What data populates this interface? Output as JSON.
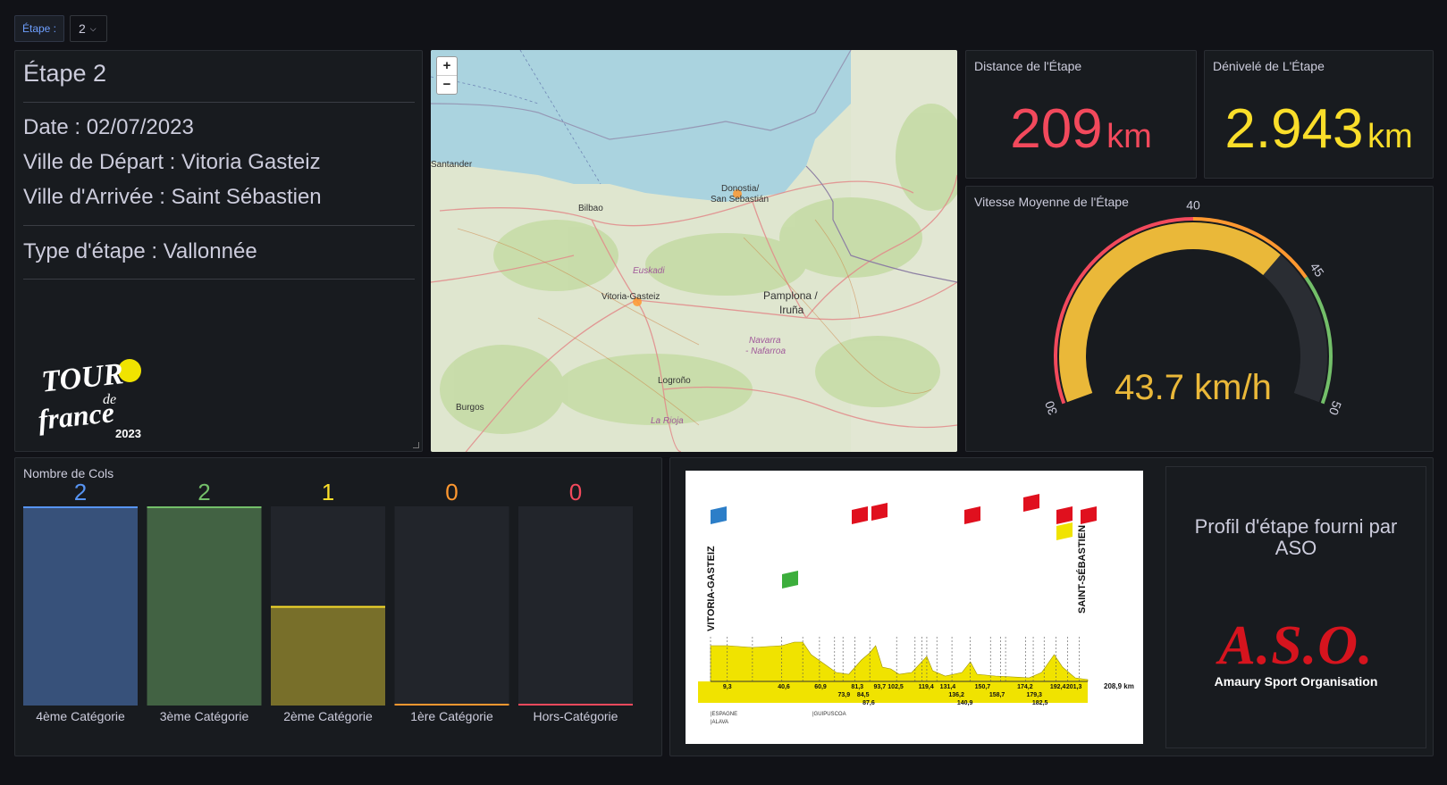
{
  "variable": {
    "label": "Étape :",
    "value": "2"
  },
  "info": {
    "title": "Étape 2",
    "date": "Date : 02/07/2023",
    "depart": "Ville de Départ : Vitoria Gasteiz",
    "arrivee": "Ville d'Arrivée : Saint Sébastien",
    "type": "Type d'étape : Vallonnée",
    "logo_text": [
      "TOUR",
      "de",
      "france",
      "2023"
    ]
  },
  "map": {
    "zoom_in": "+",
    "zoom_out": "−",
    "cities": [
      "Santander",
      "Bilbao",
      "Donostia/",
      "San Sebastián",
      "Euskadi",
      "Vitoria-Gasteiz",
      "Pamplona /",
      "Iruña",
      "Navarra",
      "- Nafarroa",
      "Logroño",
      "Burgos",
      "La Rioja"
    ]
  },
  "distance": {
    "title": "Distance de l'Étape",
    "value": "209",
    "unit": "km",
    "color": "#f2495c"
  },
  "denivele": {
    "title": "Dénivelé de L'Étape",
    "value": "2.943",
    "unit": "km",
    "color": "#fade2a"
  },
  "gauge": {
    "title": "Vitesse Moyenne de l'Étape",
    "value": 43.7,
    "display": "43.7 km/h",
    "min": 30,
    "max": 50,
    "thresholds": [
      {
        "from": 30,
        "to": 40,
        "color": "#f2495c"
      },
      {
        "from": 40,
        "to": 45,
        "color": "#ff9830"
      },
      {
        "from": 45,
        "to": 50,
        "color": "#73bf69"
      }
    ],
    "tick_labels": [
      "30",
      "40",
      "45",
      "50"
    ],
    "fill_color": "#eab839"
  },
  "cols": {
    "title": "Nombre de Cols",
    "chart_data": {
      "type": "bar",
      "categories": [
        "4ème Catégorie",
        "3ème Catégorie",
        "2ème Catégorie",
        "1ère Catégorie",
        "Hors-Catégorie"
      ],
      "values": [
        2,
        2,
        1,
        0,
        0
      ],
      "ylim": [
        0,
        2
      ],
      "colors": [
        "#5794f2",
        "#73bf69",
        "#fade2a",
        "#ff9830",
        "#f2495c"
      ]
    }
  },
  "profile": {
    "start": "VITORIA-GASTEIZ",
    "finish": "SAINT-SÉBASTIEN",
    "distance": "208,9 km",
    "km_labels": [
      "9,3",
      "40,6",
      "60,9",
      "73,9",
      "81,3",
      "84,5",
      "87,6",
      "93,7",
      "102,5",
      "119,4",
      "131,4",
      "136,2",
      "140,9",
      "150,7",
      "158,7",
      "174,2",
      "179,3",
      "182,5",
      "192,4",
      "201,3"
    ],
    "regions": [
      "|ESPAGNE",
      "|ALAVA",
      "|GUIPUSCOA"
    ],
    "aso_caption": "Profil d'étape fourni par ASO",
    "aso_logo": "A.S.O.",
    "aso_sub": "Amaury Sport Organisation"
  }
}
